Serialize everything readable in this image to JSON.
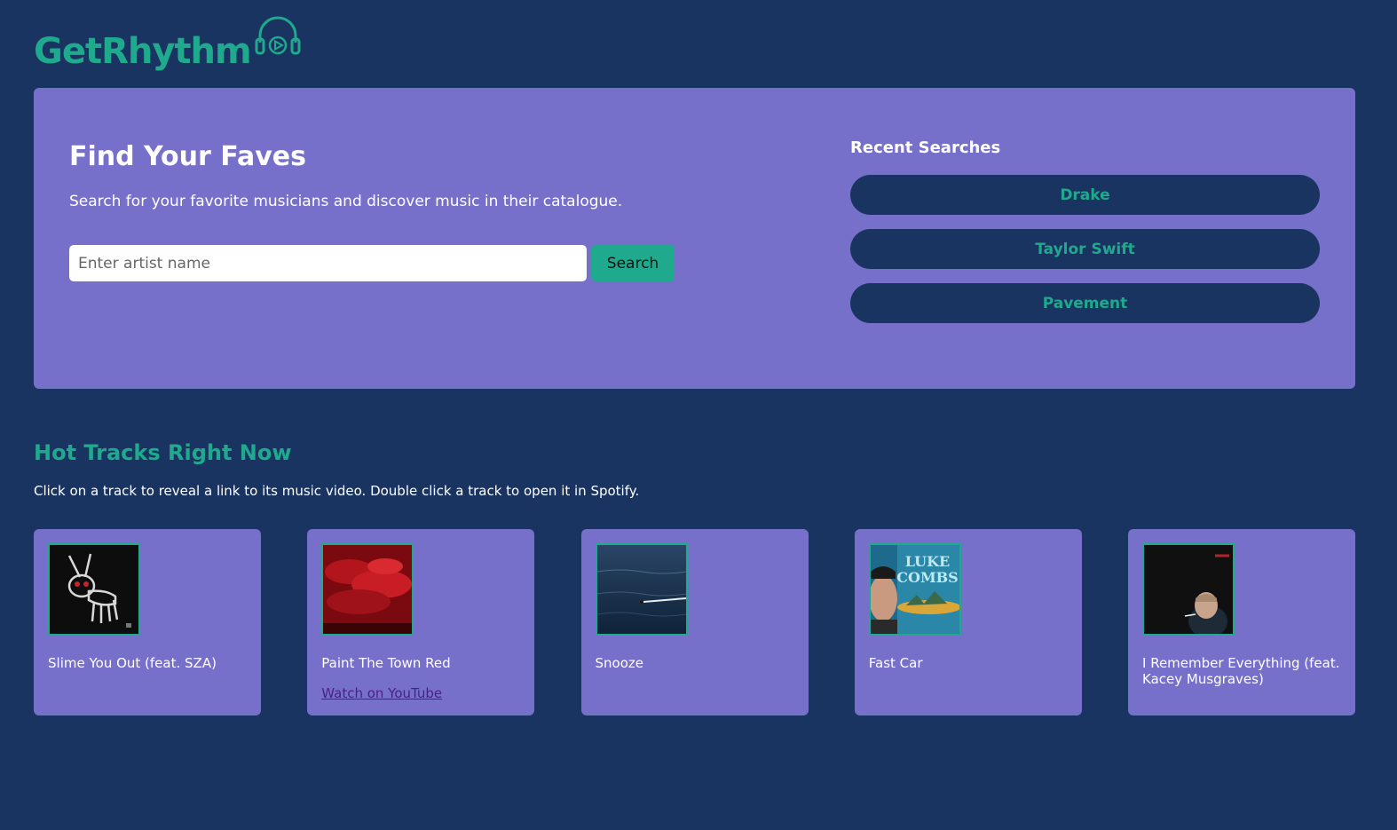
{
  "brand": {
    "name": "GetRhythm",
    "icon": "headphones-play-icon",
    "color": "#1fa98d"
  },
  "search": {
    "title": "Find Your Faves",
    "subtitle": "Search for your favorite musicians and discover music in their catalogue.",
    "placeholder": "Enter artist name",
    "value": "",
    "button_label": "Search"
  },
  "recent": {
    "title": "Recent Searches",
    "items": [
      {
        "label": "Drake"
      },
      {
        "label": "Taylor Swift"
      },
      {
        "label": "Pavement"
      }
    ]
  },
  "hot": {
    "title": "Hot Tracks Right Now",
    "subtitle": "Click on a track to reveal a link to its music video. Double click a track to open it in Spotify.",
    "tracks": [
      {
        "name": "Slime You Out (feat. SZA)",
        "cover": "for-all-the-dogs-cover",
        "link": ""
      },
      {
        "name": "Paint The Town Red",
        "cover": "red-clouds-cover",
        "link": "Watch on YouTube"
      },
      {
        "name": "Snooze",
        "cover": "ocean-cover",
        "link": ""
      },
      {
        "name": "Fast Car",
        "cover": "luke-combs-cover",
        "link": ""
      },
      {
        "name": "I Remember Everything (feat. Kacey Musgraves)",
        "cover": "dark-portrait-cover",
        "link": ""
      }
    ]
  },
  "colors": {
    "background": "#193461",
    "panel": "#7670cb",
    "accent": "#1fa98d",
    "text": "#ffffff",
    "link": "#4b1f86"
  }
}
